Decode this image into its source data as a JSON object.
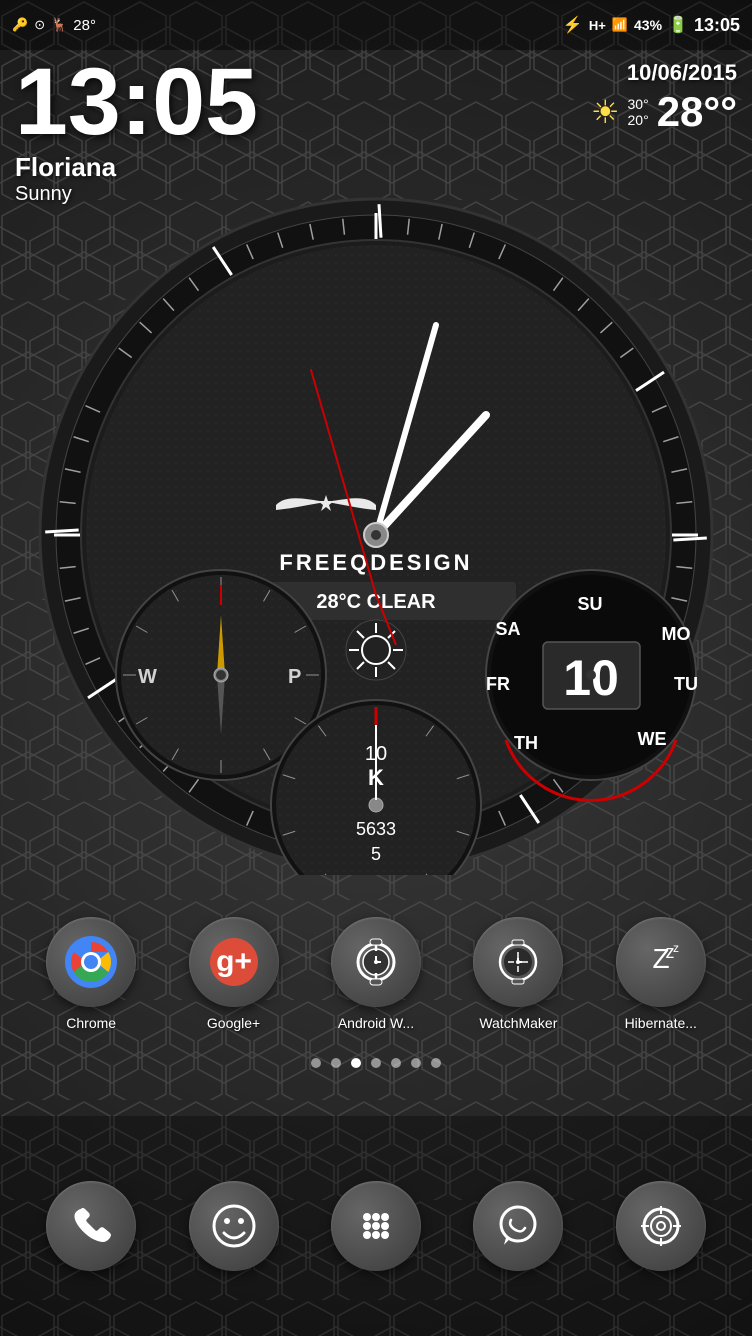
{
  "statusBar": {
    "leftIcons": [
      "key-icon",
      "circle-icon",
      "animal-icon"
    ],
    "temperature": "28°",
    "rightIcons": [
      "bluetooth-icon",
      "hp-icon",
      "signal-icon",
      "battery-icon"
    ],
    "batteryPercent": "43%",
    "time": "13:05"
  },
  "mainClock": {
    "time": "13:05",
    "location": "Floriana",
    "weather": "Sunny"
  },
  "topRight": {
    "date": "10/06/2015",
    "tempHigh": "30°",
    "tempLow": "20°",
    "tempCurrent": "28°"
  },
  "clockFace": {
    "brand": "FREEQDESIGN",
    "weatherDisplay": "28°C CLEAR",
    "dateNumber": "10",
    "days": [
      "SU",
      "MO",
      "TU",
      "WE",
      "TH",
      "FR",
      "SA"
    ]
  },
  "apps": [
    {
      "id": "chrome",
      "label": "Chrome",
      "icon": "chrome"
    },
    {
      "id": "google-plus",
      "label": "Google+",
      "icon": "gplus"
    },
    {
      "id": "android-wear",
      "label": "Android W...",
      "icon": "watch"
    },
    {
      "id": "watchmaker",
      "label": "WatchMaker",
      "icon": "watchmaker"
    },
    {
      "id": "hibernate",
      "label": "Hibernate...",
      "icon": "hibernate"
    }
  ],
  "pageIndicators": [
    1,
    2,
    3,
    4,
    5,
    6,
    7
  ],
  "activePageIndex": 2,
  "bottomNav": [
    {
      "id": "phone",
      "icon": "phone"
    },
    {
      "id": "smiley",
      "icon": "smiley"
    },
    {
      "id": "apps-grid",
      "icon": "grid"
    },
    {
      "id": "whatsapp",
      "icon": "whatsapp"
    },
    {
      "id": "camera",
      "icon": "camera"
    }
  ]
}
